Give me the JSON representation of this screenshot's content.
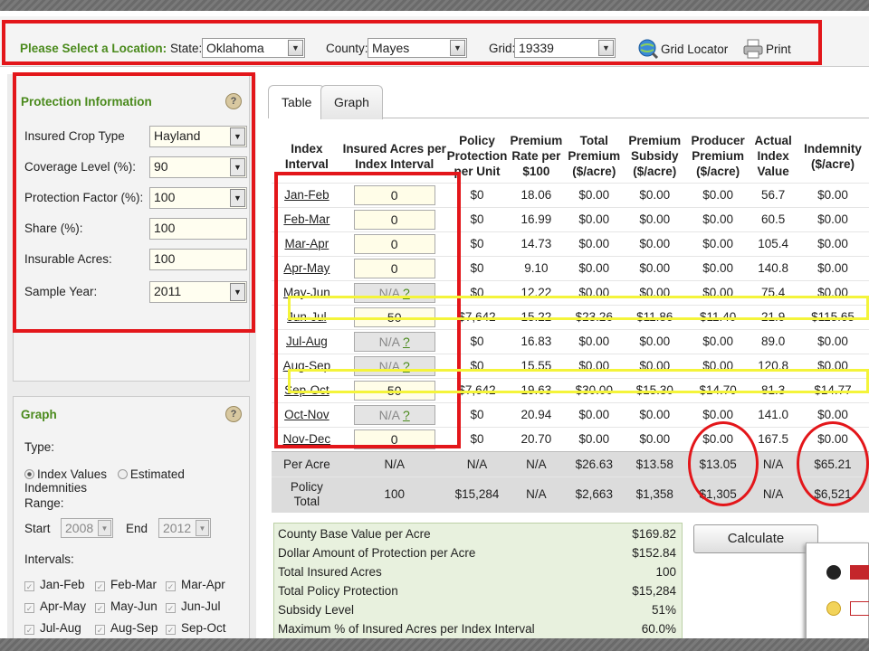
{
  "location": {
    "prompt": "Please Select a Location:",
    "state_label": "State:",
    "state_value": "Oklahoma",
    "county_label": "County:",
    "county_value": "Mayes",
    "grid_label": "Grid:",
    "grid_value": "19339",
    "grid_locator": "Grid Locator",
    "print": "Print"
  },
  "protection": {
    "title": "Protection Information",
    "help": "?",
    "fields": [
      {
        "label": "Insured Crop Type",
        "value": "Hayland"
      },
      {
        "label": "Coverage Level (%):",
        "value": "90"
      },
      {
        "label": "Protection Factor (%):",
        "value": "100"
      },
      {
        "label": "Share (%):",
        "value": "100"
      },
      {
        "label": "Insurable Acres:",
        "value": "100"
      },
      {
        "label": "Sample Year:",
        "value": "2011"
      }
    ]
  },
  "graph_panel": {
    "title": "Graph",
    "help": "?",
    "type_label": "Type:",
    "opt_index": "Index Values",
    "opt_indemn": "Estimated Indemnities",
    "range_label": "Range:",
    "start_label": "Start",
    "start_value": "2008",
    "end_label": "End",
    "end_value": "2012",
    "intervals_label": "Intervals:",
    "intervals": [
      "Jan-Feb",
      "Feb-Mar",
      "Mar-Apr",
      "Apr-May",
      "May-Jun",
      "Jun-Jul",
      "Jul-Aug",
      "Aug-Sep",
      "Sep-Oct"
    ]
  },
  "tabs": [
    "Table",
    "Graph"
  ],
  "table": {
    "headers": [
      "Index Interval",
      "Insured Acres per Index Interval",
      "Policy Protection per Unit",
      "Premium Rate per $100",
      "Total Premium ($/acre)",
      "Premium Subsidy ($/acre)",
      "Producer Premium ($/acre)",
      "Actual Index Value",
      "Indemnity ($/acre)"
    ],
    "rows": [
      [
        "Jan-Feb",
        "0",
        "$0",
        "18.06",
        "$0.00",
        "$0.00",
        "$0.00",
        "56.7",
        "$0.00"
      ],
      [
        "Feb-Mar",
        "0",
        "$0",
        "16.99",
        "$0.00",
        "$0.00",
        "$0.00",
        "60.5",
        "$0.00"
      ],
      [
        "Mar-Apr",
        "0",
        "$0",
        "14.73",
        "$0.00",
        "$0.00",
        "$0.00",
        "105.4",
        "$0.00"
      ],
      [
        "Apr-May",
        "0",
        "$0",
        "9.10",
        "$0.00",
        "$0.00",
        "$0.00",
        "140.8",
        "$0.00"
      ],
      [
        "May-Jun",
        "N/A",
        "$0",
        "12.22",
        "$0.00",
        "$0.00",
        "$0.00",
        "75.4",
        "$0.00"
      ],
      [
        "Jun-Jul",
        "50",
        "$7,642",
        "15.22",
        "$23.26",
        "$11.86",
        "$11.40",
        "21.9",
        "$115.65"
      ],
      [
        "Jul-Aug",
        "N/A",
        "$0",
        "16.83",
        "$0.00",
        "$0.00",
        "$0.00",
        "89.0",
        "$0.00"
      ],
      [
        "Aug-Sep",
        "N/A",
        "$0",
        "15.55",
        "$0.00",
        "$0.00",
        "$0.00",
        "120.8",
        "$0.00"
      ],
      [
        "Sep-Oct",
        "50",
        "$7,642",
        "19.63",
        "$30.00",
        "$15.30",
        "$14.70",
        "81.3",
        "$14.77"
      ],
      [
        "Oct-Nov",
        "N/A",
        "$0",
        "20.94",
        "$0.00",
        "$0.00",
        "$0.00",
        "141.0",
        "$0.00"
      ],
      [
        "Nov-Dec",
        "0",
        "$0",
        "20.70",
        "$0.00",
        "$0.00",
        "$0.00",
        "167.5",
        "$0.00"
      ]
    ],
    "na_help": "?",
    "per_acre": [
      "Per Acre",
      "N/A",
      "N/A",
      "N/A",
      "$26.63",
      "$13.58",
      "$13.05",
      "N/A",
      "$65.21"
    ],
    "policy_total_l1": "Policy",
    "policy_total_l2": "Total",
    "policy_total": [
      "100",
      "$15,284",
      "N/A",
      "$2,663",
      "$1,358",
      "$1,305",
      "N/A",
      "$6,521"
    ]
  },
  "summary": [
    {
      "label": "County Base Value per Acre",
      "value": "$169.82"
    },
    {
      "label": "Dollar Amount of Protection per Acre",
      "value": "$152.84"
    },
    {
      "label": "Total Insured Acres",
      "value": "100"
    },
    {
      "label": "Total Policy Protection",
      "value": "$15,284"
    },
    {
      "label": "Subsidy Level",
      "value": "51%"
    },
    {
      "label": "Maximum % of Insured Acres per Index Interval",
      "value": "60.0%"
    }
  ],
  "calculate": "Calculate",
  "colors": {
    "accent_green": "#4a8a1c",
    "annotation_red": "#e3161a",
    "highlight_yellow": "#f4f43a"
  }
}
